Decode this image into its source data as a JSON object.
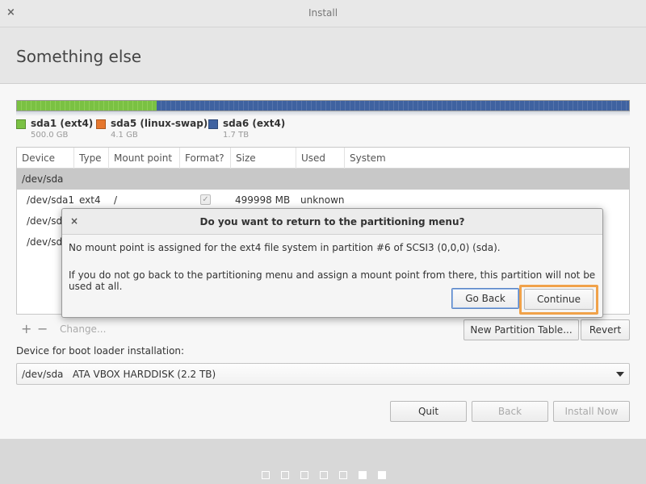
{
  "window": {
    "title": "Install",
    "close_icon": "×"
  },
  "page": {
    "title": "Something else"
  },
  "partition_bar": {
    "colors": {
      "sda1": "#7ac143",
      "sda5": "#e6772e",
      "sda6": "#3f62a0"
    }
  },
  "legend": [
    {
      "name": "sda1 (ext4)",
      "size": "500.0 GB",
      "color": "#7ac143"
    },
    {
      "name": "sda5 (linux-swap)",
      "size": "4.1 GB",
      "color": "#e6772e"
    },
    {
      "name": "sda6 (ext4)",
      "size": "1.7 TB",
      "color": "#3f62a0"
    }
  ],
  "table": {
    "headers": [
      "Device",
      "Type",
      "Mount point",
      "Format?",
      "Size",
      "Used",
      "System"
    ],
    "group_row": "/dev/sda",
    "rows": [
      {
        "device": "/dev/sda1",
        "type": "ext4",
        "mount": "/",
        "format_checked": true,
        "size": "499998 MB",
        "used": "unknown"
      },
      {
        "device": "/dev/sda"
      },
      {
        "device": "/dev/sda"
      }
    ]
  },
  "toolbar": {
    "add": "+",
    "remove": "−",
    "change": "Change...",
    "new_table": "New Partition Table...",
    "revert": "Revert"
  },
  "bootloader": {
    "label": "Device for boot loader installation:",
    "value": "/dev/sda   ATA VBOX HARDDISK (2.2 TB)"
  },
  "buttons": {
    "quit": "Quit",
    "back": "Back",
    "install": "Install Now"
  },
  "dialog": {
    "close_icon": "×",
    "title": "Do you want to return to the partitioning menu?",
    "line1": "No mount point is assigned for the ext4 file system in partition #6 of SCSI3 (0,0,0) (sda).",
    "line2": "If you do not go back to the partitioning menu and assign a mount point from there, this partition will not be used at all.",
    "go_back": "Go Back",
    "continue": "Continue"
  },
  "progress": {
    "total_steps": 7,
    "active_steps": [
      6,
      7
    ]
  }
}
